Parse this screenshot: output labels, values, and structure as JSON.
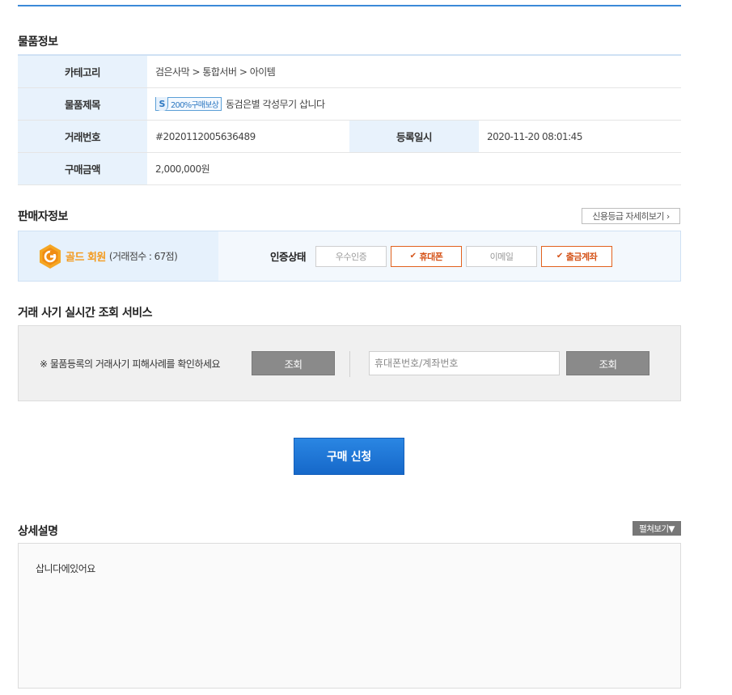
{
  "item_info": {
    "title": "물품정보",
    "category_label": "카테고리",
    "category_value": "검은사막 > 통합서버 > 아이템",
    "subject_label": "물품제목",
    "subject_badge_icon": "S",
    "subject_badge": "200%구매보상",
    "subject_value": "동검은별 각성무기 삽니다",
    "trade_no_label": "거래번호",
    "trade_no_value": "#2020112005636489",
    "reg_date_label": "등록일시",
    "reg_date_value": "2020-11-20 08:01:45",
    "price_label": "구매금액",
    "price_value": "2,000,000원"
  },
  "seller_info": {
    "title": "판매자정보",
    "credit_detail_button": "신용등급 자세히보기 ›",
    "grade_name": "골드 회원",
    "grade_score": "(거래점수 : 67점)",
    "cert_label": "인증상태",
    "certs": [
      {
        "label": "우수인증",
        "active": false
      },
      {
        "label": "휴대폰",
        "active": true
      },
      {
        "label": "이메일",
        "active": false
      },
      {
        "label": "출금계좌",
        "active": true
      }
    ],
    "check_icon": "✔"
  },
  "fraud_check": {
    "title": "거래 사기 실시간 조회 서비스",
    "notice": "※ 물품등록의 거래사기 피해사례를 확인하세요",
    "check_button_1": "조회",
    "input_placeholder": "휴대폰번호/계좌번호",
    "input_value": "",
    "check_button_2": "조회"
  },
  "buy_button": "구매 신청",
  "detail": {
    "title": "상세설명",
    "expand_button": "펼쳐보기▼",
    "content": "삽니다에있어요"
  },
  "colors": {
    "accent_blue": "#3b8ad8",
    "header_bg": "#e8f2fc",
    "gold": "#f39a1d",
    "cert_active": "#e2611e",
    "buy_button": "#1f78d6"
  }
}
